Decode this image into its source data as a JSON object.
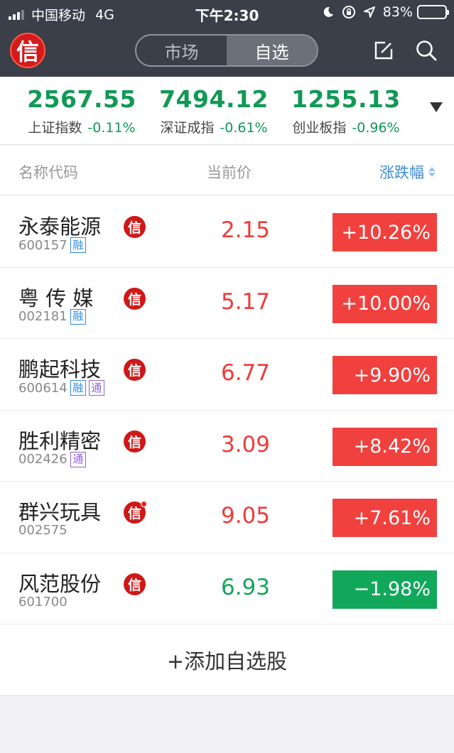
{
  "status_bar": {
    "carrier": "中国移动",
    "network": "4G",
    "time": "下午2:30",
    "battery_percent": "83%",
    "battery_level": 0.83
  },
  "nav": {
    "logo_char": "信",
    "tabs": [
      {
        "label": "市场",
        "active": false
      },
      {
        "label": "自选",
        "active": true
      }
    ],
    "edit_icon": "edit-icon",
    "search_icon": "search-icon"
  },
  "indices": [
    {
      "value": "2567.55",
      "name": "上证指数",
      "change": "-0.11%"
    },
    {
      "value": "7494.12",
      "name": "深证成指",
      "change": "-0.61%"
    },
    {
      "value": "1255.13",
      "name": "创业板指",
      "change": "-0.96%"
    }
  ],
  "columns": {
    "name": "名称代码",
    "price": "当前价",
    "change": "涨跌幅"
  },
  "stocks": [
    {
      "name": "永泰能源",
      "code": "600157",
      "tags": [
        "融"
      ],
      "badge": "信",
      "price": "2.15",
      "change": "+10.26%",
      "direction": "up"
    },
    {
      "name": "粤 传 媒",
      "code": "002181",
      "tags": [
        "融"
      ],
      "badge": "信",
      "price": "5.17",
      "change": "+10.00%",
      "direction": "up"
    },
    {
      "name": "鹏起科技",
      "code": "600614",
      "tags": [
        "融",
        "通"
      ],
      "badge": "信",
      "price": "6.77",
      "change": "+9.90%",
      "direction": "up"
    },
    {
      "name": "胜利精密",
      "code": "002426",
      "tags": [
        "通"
      ],
      "badge": "信",
      "price": "3.09",
      "change": "+8.42%",
      "direction": "up"
    },
    {
      "name": "群兴玩具",
      "code": "002575",
      "tags": [],
      "badge": "信",
      "price": "9.05",
      "change": "+7.61%",
      "direction": "up"
    },
    {
      "name": "风范股份",
      "code": "601700",
      "tags": [],
      "badge": "信",
      "price": "6.93",
      "change": "−1.98%",
      "direction": "down"
    }
  ],
  "add_button": "+添加自选股",
  "colors": {
    "header_bg": "#3b3f49",
    "up_red": "#f0413f",
    "down_green": "#11a85b",
    "index_green": "#119955",
    "accent_blue": "#3d8bd8"
  }
}
